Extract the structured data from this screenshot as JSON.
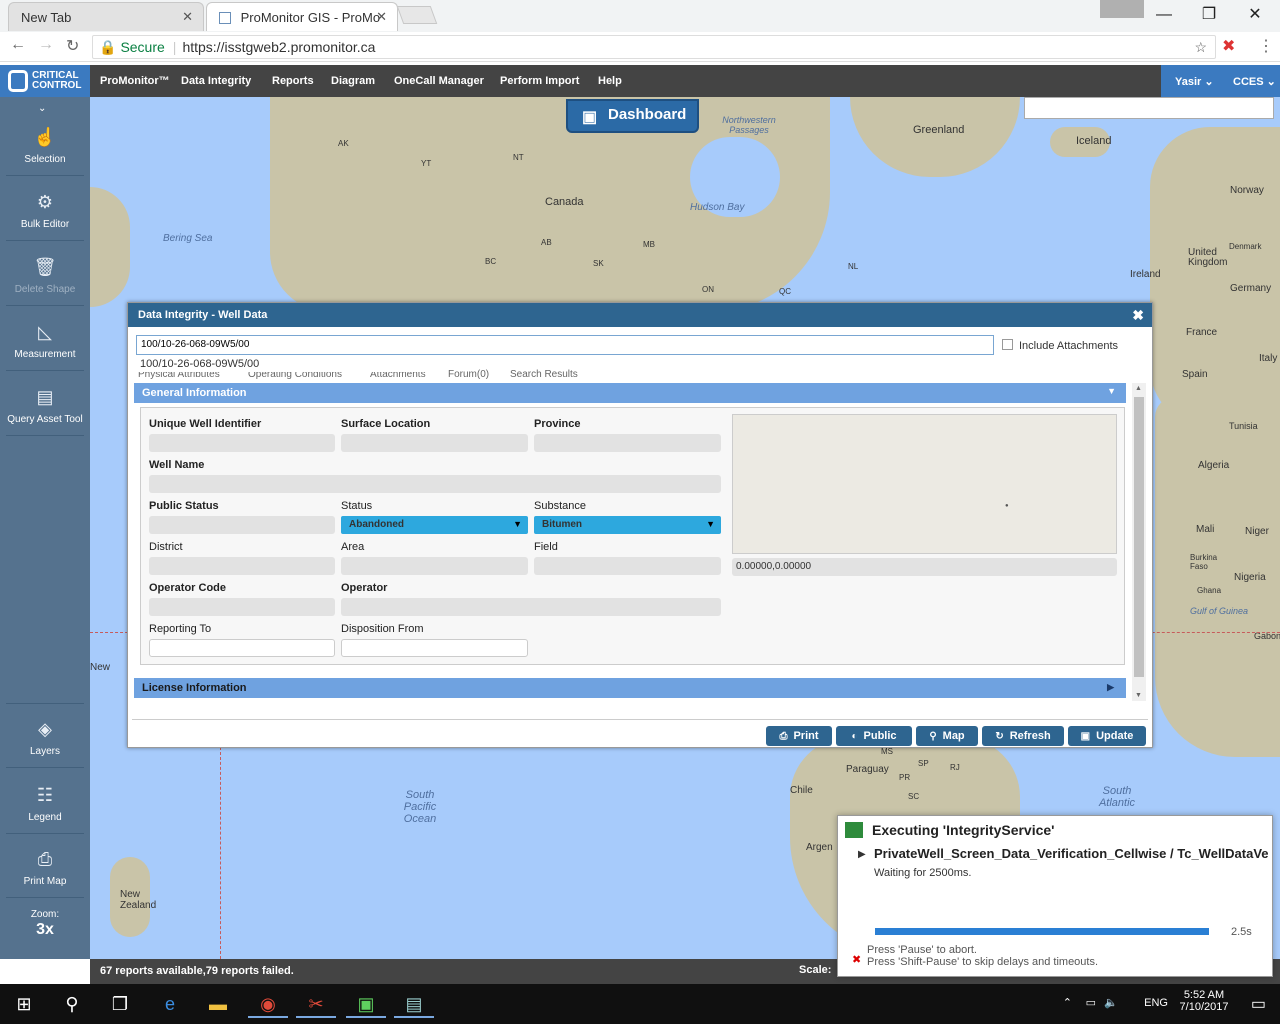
{
  "browser": {
    "tabs": [
      {
        "label": "New Tab"
      },
      {
        "label": "ProMonitor GIS - ProMo"
      }
    ],
    "secure_label": "Secure",
    "url": "https://isstgweb2.promonitor.ca"
  },
  "app": {
    "logo_line1": "CRITICAL",
    "logo_line2": "CONTROL",
    "menu": [
      "ProMonitor™",
      "Data Integrity",
      "Reports",
      "Diagram",
      "OneCall Manager",
      "Perform Import",
      "Help"
    ],
    "user": "Yasir",
    "org": "CCES"
  },
  "sidebar": {
    "items": [
      {
        "label": "Selection",
        "icon": "hand-pointer-icon"
      },
      {
        "label": "Bulk Editor",
        "icon": "bulk-editor-icon"
      },
      {
        "label": "Delete Shape",
        "icon": "trash-icon"
      },
      {
        "label": "Measurement",
        "icon": "ruler-icon"
      },
      {
        "label": "Query Asset Tool",
        "icon": "query-icon"
      },
      {
        "label": "Layers",
        "icon": "layers-icon"
      },
      {
        "label": "Legend",
        "icon": "legend-icon"
      },
      {
        "label": "Print Map",
        "icon": "printer-icon"
      }
    ],
    "zoom_label": "Zoom:",
    "zoom_value": "3x"
  },
  "dashboard_label": "Dashboard",
  "map_labels": {
    "greenland": "Greenland",
    "iceland": "Iceland",
    "norway": "Norway",
    "denmark": "Denmark",
    "uk": "United Kingdom",
    "ireland": "Ireland",
    "germany": "Germany",
    "france": "France",
    "italy": "Italy",
    "spain": "Spain",
    "tunisia": "Tunisia",
    "algeria": "Algeria",
    "mali": "Mali",
    "niger": "Niger",
    "burkina": "Burkina Faso",
    "nigeria": "Nigeria",
    "ghana": "Ghana",
    "gabon": "Gabon",
    "canada": "Canada",
    "ak": "AK",
    "yt": "YT",
    "nt": "NT",
    "bc": "BC",
    "ab": "AB",
    "sk": "SK",
    "mb": "MB",
    "on": "ON",
    "qc": "QC",
    "nl": "NL",
    "bering": "Bering Sea",
    "hudson": "Hudson Bay",
    "nw_passages": "Northwestern Passages",
    "guinea": "Gulf of Guinea",
    "paraguay": "Paraguay",
    "chile": "Chile",
    "argentina": "Argen",
    "pr": "PR",
    "sp": "SP",
    "rj": "RJ",
    "sc": "SC",
    "ms": "MS",
    "south_pacific": "South Pacific Ocean",
    "south_atlantic": "South Atlantic",
    "new_zealand": "New Zealand",
    "new": "New"
  },
  "dialog": {
    "title": "Data Integrity - Well Data",
    "search_value": "100/10-26-068-09W5/00",
    "suggestion": "100/10-26-068-09W5/00",
    "include_attachments": "Include Attachments",
    "tabs": [
      "Physical Attributes",
      "Operating Conditions",
      "Attachments",
      "Forum(0)",
      "Search Results"
    ],
    "general_header": "General Information",
    "license_header": "License Information",
    "fields": {
      "uwi": "Unique Well Identifier",
      "surface_location": "Surface Location",
      "province": "Province",
      "well_name": "Well Name",
      "public_status": "Public Status",
      "status": "Status",
      "status_value": "Abandoned",
      "substance": "Substance",
      "substance_value": "Bitumen",
      "district": "District",
      "area": "Area",
      "field": "Field",
      "operator_code": "Operator Code",
      "operator": "Operator",
      "reporting_to": "Reporting To",
      "disposition_from": "Disposition From",
      "coordinates": "0.00000,0.00000"
    },
    "buttons": [
      "Print",
      "Public",
      "Map",
      "Refresh",
      "Update"
    ]
  },
  "statusbar": {
    "reports": "67 reports available,79 reports failed.",
    "scale_label": "Scale:"
  },
  "runner": {
    "title": "Executing 'IntegrityService'",
    "test": "PrivateWell_Screen_Data_Verification_Cellwise / Tc_WellDataVerif...",
    "waiting": "Waiting for 2500ms.",
    "progress": 1.0,
    "time": "2.5s",
    "hint1": "Press 'Pause' to abort.",
    "hint2": "Press 'Shift-Pause' to skip delays and timeouts."
  },
  "taskbar": {
    "lang": "ENG",
    "time": "5:52 AM",
    "date": "7/10/2017"
  }
}
